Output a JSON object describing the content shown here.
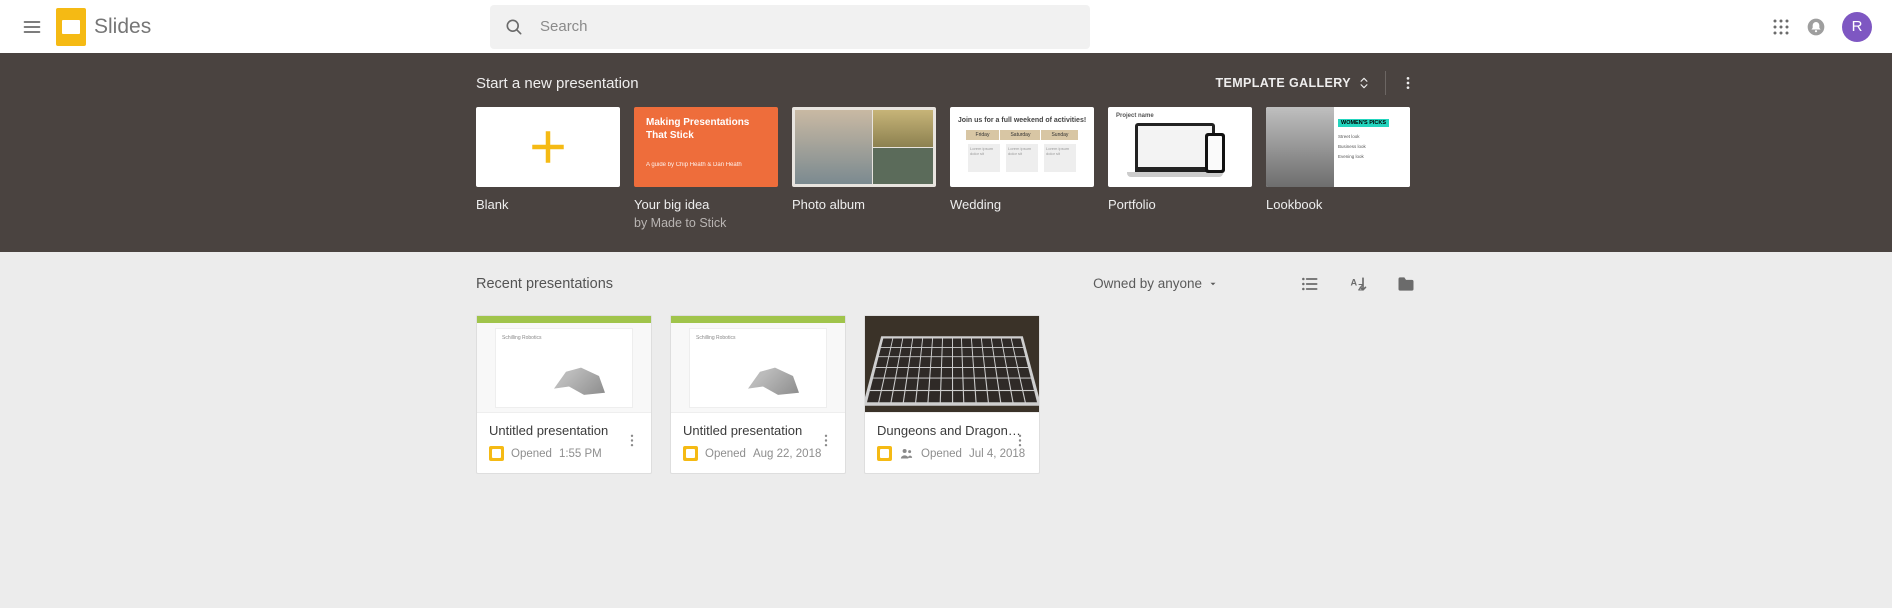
{
  "header": {
    "app_name": "Slides",
    "search_placeholder": "Search",
    "avatar_initial": "R"
  },
  "templates": {
    "section_title": "Start a new presentation",
    "gallery_button": "TEMPLATE GALLERY",
    "items": [
      {
        "name": "Blank",
        "sub": ""
      },
      {
        "name": "Your big idea",
        "sub": "by Made to Stick"
      },
      {
        "name": "Photo album",
        "sub": ""
      },
      {
        "name": "Wedding",
        "sub": ""
      },
      {
        "name": "Portfolio",
        "sub": ""
      },
      {
        "name": "Lookbook",
        "sub": ""
      }
    ],
    "bigidea_text": "Making Presentations That Stick",
    "bigidea_sub": "A guide by Chip Heath & Dan Heath",
    "wedding_head": "Join us for a full weekend of activities!",
    "portfolio_label": "Project name",
    "lookbook_badge": "WOMEN'S PICKS"
  },
  "recent": {
    "section_title": "Recent presentations",
    "owner_filter": "Owned by anyone",
    "items": [
      {
        "title": "Untitled presentation",
        "opened_label": "Opened",
        "opened_value": "1:55 PM",
        "shared": false
      },
      {
        "title": "Untitled presentation",
        "opened_label": "Opened",
        "opened_value": "Aug 22, 2018",
        "shared": false
      },
      {
        "title": "Dungeons and Dragons Miniatures",
        "opened_label": "Opened",
        "opened_value": "Jul 4, 2018",
        "shared": true
      }
    ]
  }
}
